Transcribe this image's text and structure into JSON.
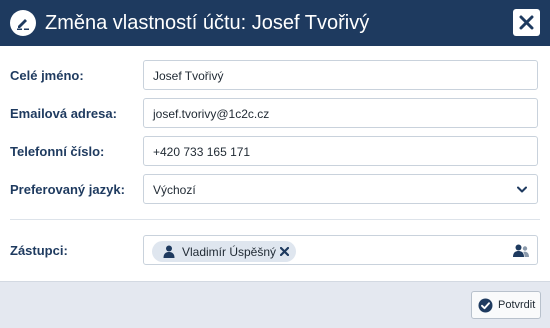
{
  "dialog": {
    "title": "Změna vlastností účtu: Josef Tvořivý",
    "icon": "edit-icon",
    "close_icon": "close-icon"
  },
  "form": {
    "full_name": {
      "label": "Celé jméno:",
      "value": "Josef Tvořivý"
    },
    "email": {
      "label": "Emailová adresa:",
      "value": "josef.tvorivy@1c2c.cz"
    },
    "phone": {
      "label": "Telefonní číslo:",
      "value": "+420 733 165 171"
    },
    "language": {
      "label": "Preferovaný jazyk:",
      "value": "Výchozí"
    },
    "deputies": {
      "label": "Zástupci:",
      "chips": [
        {
          "label": "Vladimír Úspěšný",
          "icon": "user-icon"
        }
      ],
      "picker_icon": "users-icon"
    }
  },
  "footer": {
    "confirm_label": "Potvrdit",
    "confirm_icon": "check-circle-icon"
  },
  "colors": {
    "titlebar": "#1e3a5f",
    "label": "#1e3a5f",
    "footer": "#e4e8f0",
    "chip": "#dfe6ef"
  }
}
